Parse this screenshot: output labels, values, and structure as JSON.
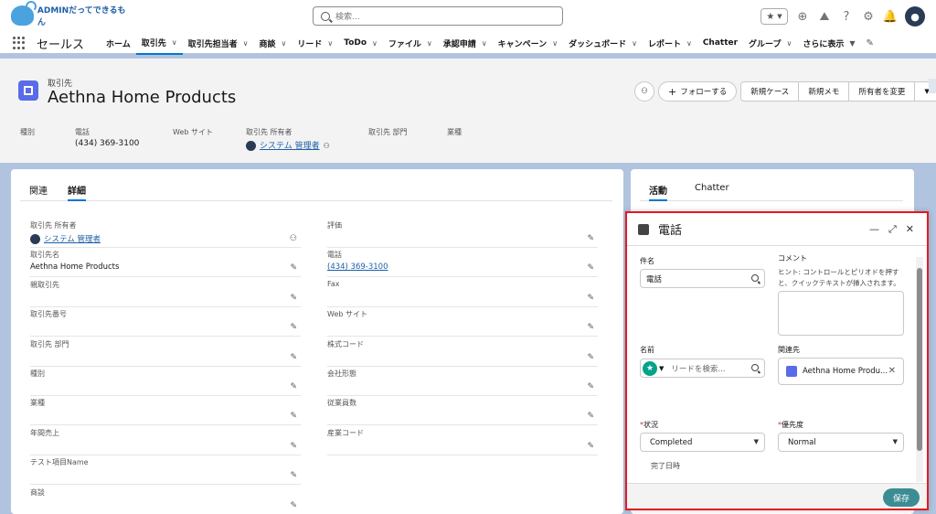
{
  "header": {
    "logo_text": "ADMINだってできるもん",
    "search_placeholder": "検索...",
    "icons": [
      "star-icon",
      "add-icon",
      "trailhead-icon",
      "help-icon",
      "gear-icon",
      "bell-icon",
      "avatar"
    ]
  },
  "nav": {
    "app_name": "セールス",
    "items": [
      {
        "label": "ホーム",
        "chev": false,
        "active": false
      },
      {
        "label": "取引先",
        "chev": true,
        "active": true
      },
      {
        "label": "取引先担当者",
        "chev": true,
        "active": false
      },
      {
        "label": "商談",
        "chev": true,
        "active": false
      },
      {
        "label": "リード",
        "chev": true,
        "active": false
      },
      {
        "label": "ToDo",
        "chev": true,
        "active": false
      },
      {
        "label": "ファイル",
        "chev": true,
        "active": false
      },
      {
        "label": "承認申請",
        "chev": true,
        "active": false
      },
      {
        "label": "キャンペーン",
        "chev": true,
        "active": false
      },
      {
        "label": "ダッシュボード",
        "chev": true,
        "active": false
      },
      {
        "label": "レポート",
        "chev": true,
        "active": false
      },
      {
        "label": "Chatter",
        "chev": false,
        "active": false
      },
      {
        "label": "グループ",
        "chev": true,
        "active": false
      },
      {
        "label": "さらに表示",
        "chev": true,
        "active": false
      }
    ]
  },
  "record": {
    "type_label": "取引先",
    "name": "Aethna Home Products",
    "follow_label": "フォローする",
    "actions": [
      "新規ケース",
      "新規メモ",
      "所有者を変更"
    ],
    "highlights": {
      "type_label": "種別",
      "phone_label": "電話",
      "phone_value": "(434) 369-3100",
      "web_label": "Web サイト",
      "owner_label": "取引先 所有者",
      "owner_value": "システム 管理者",
      "division_label": "取引先 部門",
      "industry_label": "業種"
    }
  },
  "detail": {
    "tabs": [
      "関連",
      "詳細"
    ],
    "active_tab": "詳細",
    "left_fields": [
      {
        "label": "取引先 所有者",
        "value": "システム 管理者",
        "link": true
      },
      {
        "label": "取引先名",
        "value": "Aethna Home Products",
        "link": false
      },
      {
        "label": "親取引先",
        "value": "",
        "link": false
      },
      {
        "label": "取引先番号",
        "value": "",
        "link": false
      },
      {
        "label": "取引先 部門",
        "value": "",
        "link": false
      },
      {
        "label": "種別",
        "value": "",
        "link": false
      },
      {
        "label": "業種",
        "value": "",
        "link": false
      },
      {
        "label": "年間売上",
        "value": "",
        "link": false
      },
      {
        "label": "テスト項目Name",
        "value": "",
        "link": false
      },
      {
        "label": "商談",
        "value": "",
        "link": false
      }
    ],
    "right_fields": [
      {
        "label": "評価",
        "value": "",
        "link": false
      },
      {
        "label": "電話",
        "value": "(434) 369-3100",
        "link": true
      },
      {
        "label": "Fax",
        "value": "",
        "link": false
      },
      {
        "label": "Web サイト",
        "value": "",
        "link": false
      },
      {
        "label": "株式コード",
        "value": "",
        "link": false
      },
      {
        "label": "会社形態",
        "value": "",
        "link": false
      },
      {
        "label": "従業員数",
        "value": "",
        "link": false
      },
      {
        "label": "産業コード",
        "value": "",
        "link": false
      }
    ]
  },
  "activity": {
    "tabs": [
      "活動",
      "Chatter"
    ],
    "active_tab": "活動"
  },
  "call_modal": {
    "title": "電話",
    "subject_label": "件名",
    "subject_value": "電話",
    "comment_label": "コメント",
    "comment_hint": "ヒント: コントロールとピリオドを押すと、クイックテキストが挿入されます。",
    "name_label": "名前",
    "name_placeholder": "リードを検索...",
    "related_label": "関連先",
    "related_value": "Aethna Home Produ...",
    "status_label": "状況",
    "status_value": "Completed",
    "priority_label": "優先度",
    "priority_value": "Normal",
    "due_label": "完了日時",
    "save_label": "保存"
  },
  "colors": {
    "brand": "#0176d3",
    "background": "#b0c4df",
    "highlight_border": "#e6191f",
    "save_button": "#3c8c94",
    "account_icon": "#596be8"
  }
}
